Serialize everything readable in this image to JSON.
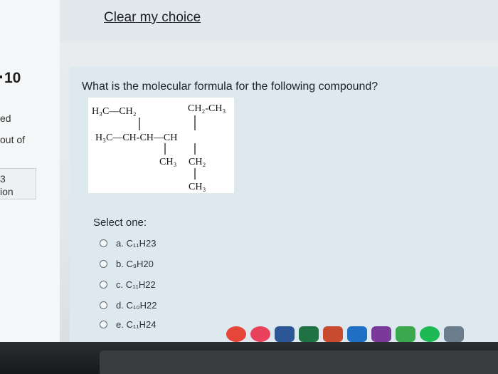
{
  "top": {
    "clear_choice": "Clear my choice"
  },
  "sidebar": {
    "question_number": "10",
    "fragments": [
      "ed",
      "out of",
      "3",
      "ion"
    ]
  },
  "question": {
    "text": "What is the molecular formula for the following compound?",
    "structure": {
      "row1_left": "H₃C—CH₂",
      "row1_right": "CH₂-CH₃",
      "row2": "H₃C—CH-CH—CH",
      "row3_left": "CH₃",
      "row3_right": "CH₂",
      "row4": "CH₃"
    },
    "select_prompt": "Select one:",
    "options": [
      "a. C₁₁H23",
      "b. C₉H20",
      "c. C₁₁H22",
      "d. C₁₀H22",
      "e. C₁₁H24"
    ]
  },
  "taskbar": {
    "icons": [
      "chrome-icon",
      "music-icon",
      "word-icon",
      "excel-icon",
      "powerpoint-icon",
      "outlook-icon",
      "onenote-icon",
      "maps-icon",
      "spotify-icon",
      "photos-icon"
    ],
    "colors": [
      "#e6453a",
      "#e9425d",
      "#2b5797",
      "#1f7244",
      "#c84b30",
      "#1f6fc4",
      "#7a3a9a",
      "#3aa84c",
      "#1db954",
      "#6b7c8c"
    ]
  }
}
